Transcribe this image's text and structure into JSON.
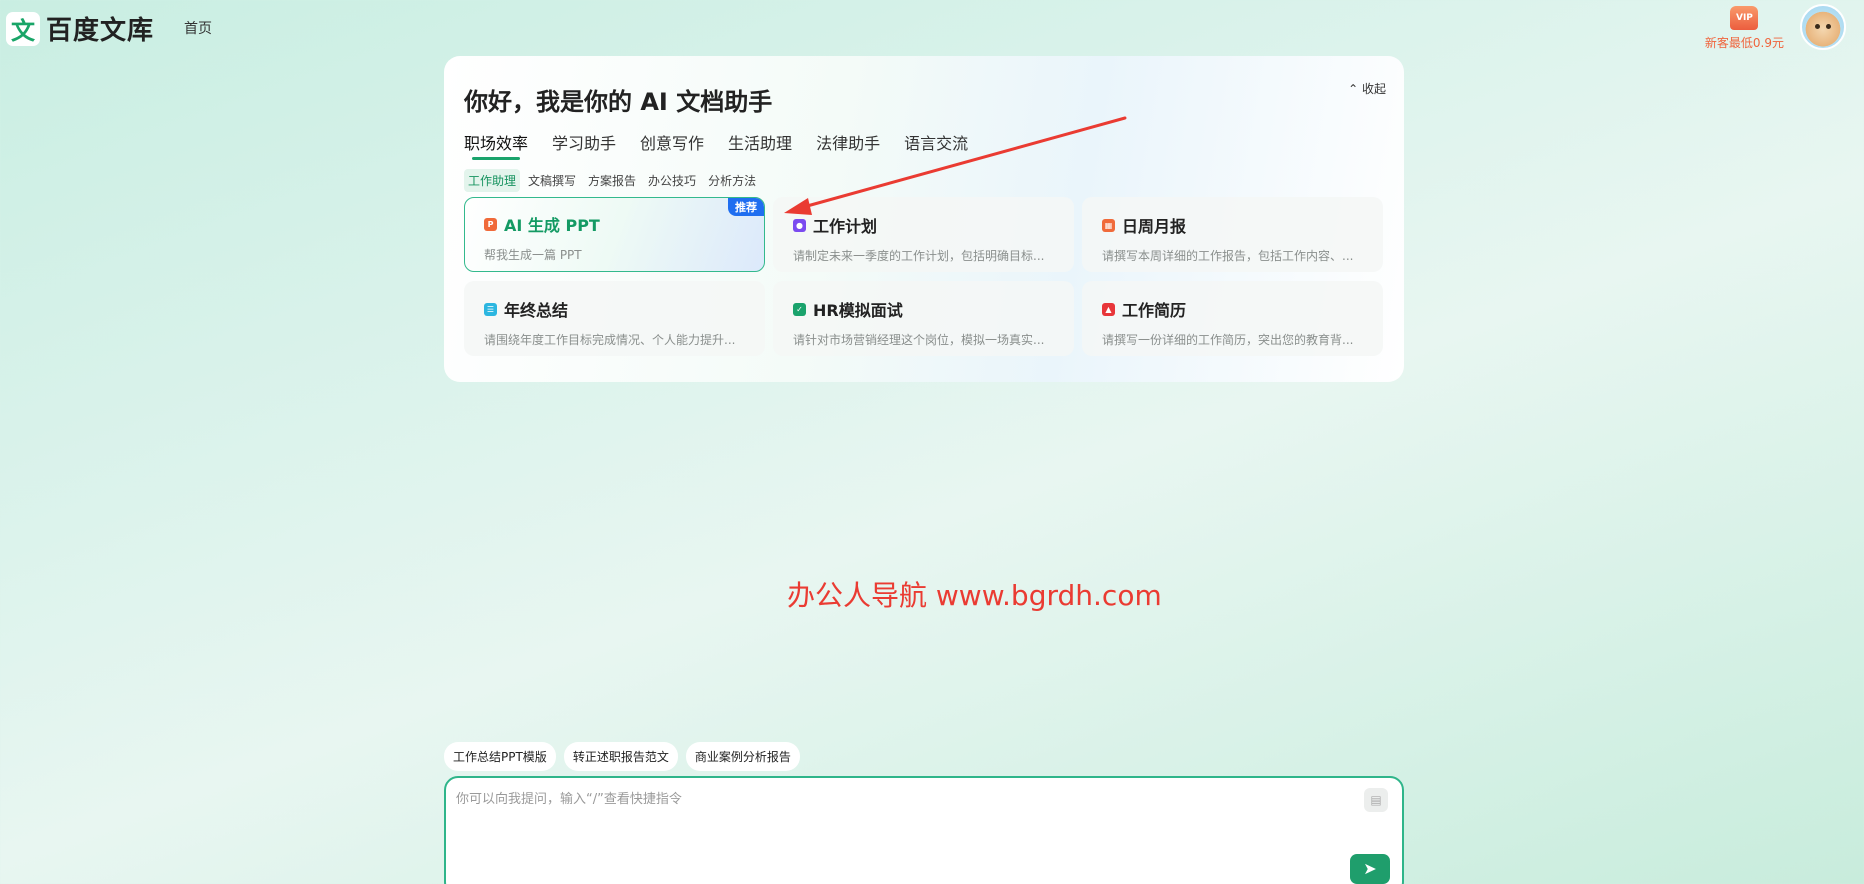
{
  "header": {
    "logo_glyph": "文",
    "logo_text": "百度文库",
    "nav_home": "首页",
    "vip_badge": "VIP",
    "vip_text": "新客最低0.9元"
  },
  "assistant": {
    "title": "你好，我是你的 AI 文档助手",
    "collapse_label": "收起",
    "tabs": [
      "职场效率",
      "学习助手",
      "创意写作",
      "生活助理",
      "法律助手",
      "语言交流"
    ],
    "active_tab": "职场效率",
    "subtabs": [
      "工作助理",
      "文稿撰写",
      "方案报告",
      "办公技巧",
      "分析方法"
    ],
    "active_subtab": "工作助理",
    "cards": [
      {
        "title": "AI 生成 PPT",
        "desc": "帮我生成一篇 PPT",
        "badge": "推荐",
        "icon": "ppt-icon",
        "icon_color": "#f06a3a"
      },
      {
        "title": "工作计划",
        "desc": "请制定未来一季度的工作计划，包括明确目标...",
        "icon": "plan-icon",
        "icon_color": "#7b4bf0"
      },
      {
        "title": "日周月报",
        "desc": "请撰写本周详细的工作报告，包括工作内容、...",
        "icon": "report-icon",
        "icon_color": "#f06a3a"
      },
      {
        "title": "年终总结",
        "desc": "请围绕年度工作目标完成情况、个人能力提升...",
        "icon": "summary-icon",
        "icon_color": "#2cb6e0"
      },
      {
        "title": "HR模拟面试",
        "desc": "请针对市场营销经理这个岗位，模拟一场真实...",
        "icon": "interview-icon",
        "icon_color": "#1aa36c"
      },
      {
        "title": "工作简历",
        "desc": "请撰写一份详细的工作简历，突出您的教育背...",
        "icon": "resume-icon",
        "icon_color": "#e8363a"
      }
    ]
  },
  "watermark": "办公人导航 www.bgrdh.com",
  "suggestions": [
    "工作总结PPT模版",
    "转正述职报告范文",
    "商业案例分析报告"
  ],
  "input": {
    "placeholder": "你可以向我提问，输入“/”查看快捷指令",
    "value": ""
  },
  "colors": {
    "accent": "#1aa36c",
    "badge": "#1f6ef0",
    "annotation": "#ea3b32"
  }
}
